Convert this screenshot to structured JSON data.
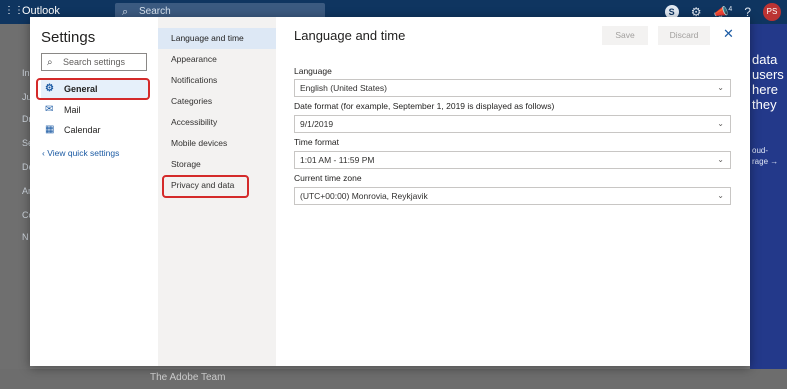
{
  "background": {
    "app_title": "Outlook",
    "search_placeholder": "Search",
    "notification_count": "4",
    "avatar_initials": "PS",
    "left_rail_items": [
      "In",
      "Ju",
      "Dr",
      "Se",
      "De",
      "Ar",
      "Co",
      "N"
    ],
    "ad_text": [
      "data",
      "users",
      "here",
      "they"
    ],
    "ad_small": [
      "oud-",
      "rage →"
    ],
    "bottom_sender": "The Adobe Team"
  },
  "settings": {
    "title": "Settings",
    "search_placeholder": "Search settings",
    "nav": [
      {
        "label": "General",
        "icon": "gear-icon",
        "selected": true
      },
      {
        "label": "Mail",
        "icon": "mail-icon",
        "selected": false
      },
      {
        "label": "Calendar",
        "icon": "calendar-icon",
        "selected": false
      }
    ],
    "quick_settings_link": "View quick settings"
  },
  "general_nav": [
    "Language and time",
    "Appearance",
    "Notifications",
    "Categories",
    "Accessibility",
    "Mobile devices",
    "Storage",
    "Privacy and data"
  ],
  "content": {
    "title": "Language and time",
    "save_label": "Save",
    "discard_label": "Discard",
    "fields": [
      {
        "label": "Language",
        "value": "English (United States)"
      },
      {
        "label": "Date format (for example, September 1, 2019 is displayed as follows)",
        "value": "9/1/2019"
      },
      {
        "label": "Time format",
        "value": "1:01 AM - 11:59 PM"
      },
      {
        "label": "Current time zone",
        "value": "(UTC+00:00) Monrovia, Reykjavik"
      }
    ]
  },
  "colors": {
    "accent": "#1c5ba4",
    "highlight_box": "#d42a2a",
    "top_bar": "#0f3560"
  }
}
